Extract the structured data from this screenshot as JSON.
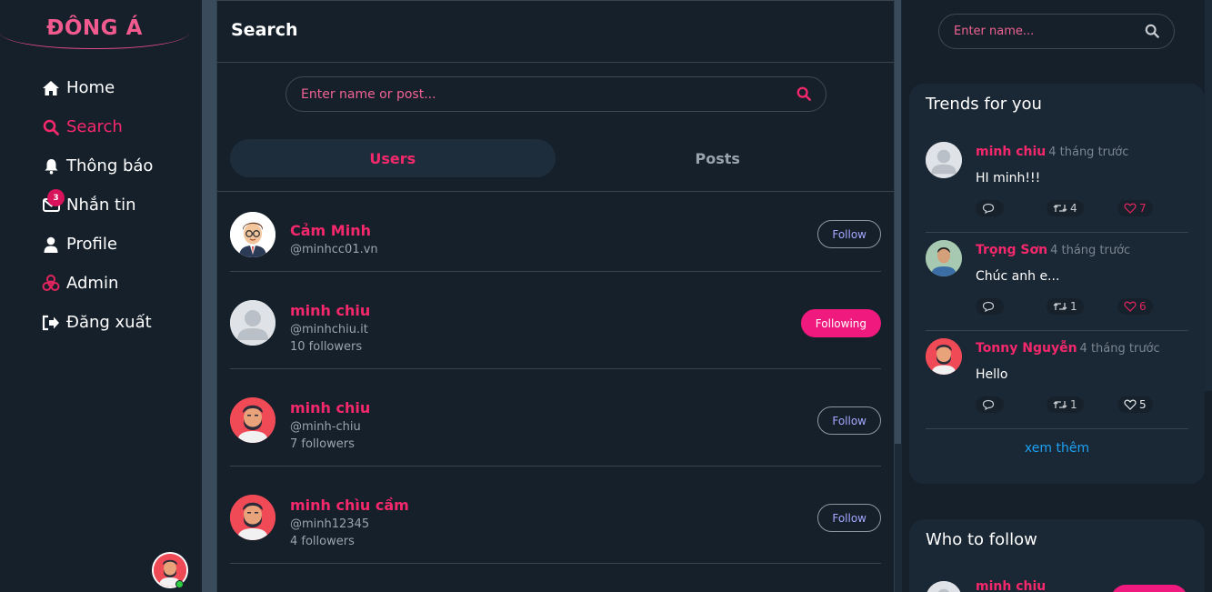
{
  "app": {
    "logo": "ĐÔNG Á"
  },
  "sidebar": {
    "items": [
      {
        "label": "Home",
        "icon": "home-icon",
        "active": false
      },
      {
        "label": "Search",
        "icon": "search-icon",
        "active": true
      },
      {
        "label": "Thông báo",
        "icon": "bell-icon",
        "active": false
      },
      {
        "label": "Nhắn tin",
        "icon": "mail-icon",
        "active": false,
        "badge": "3"
      },
      {
        "label": "Profile",
        "icon": "user-icon",
        "active": false
      },
      {
        "label": "Admin",
        "icon": "biohazard-icon",
        "active": false
      },
      {
        "label": "Đăng xuất",
        "icon": "logout-icon",
        "active": false
      }
    ]
  },
  "main": {
    "title": "Search",
    "search": {
      "placeholder": "Enter name or post..."
    },
    "tabs": [
      {
        "label": "Users",
        "active": true
      },
      {
        "label": "Posts",
        "active": false
      }
    ],
    "users": [
      {
        "name": "Cảm Minh",
        "handle": "@minhcc01.vn",
        "followers": "",
        "button": "Follow",
        "following": false
      },
      {
        "name": "minh chiu",
        "handle": "@minhchiu.it",
        "followers": "10 followers",
        "button": "Following",
        "following": true
      },
      {
        "name": "minh chiu",
        "handle": "@minh-chiu",
        "followers": "7 followers",
        "button": "Follow",
        "following": false
      },
      {
        "name": "minh chìu cầm",
        "handle": "@minh12345",
        "followers": "4 followers",
        "button": "Follow",
        "following": false
      }
    ]
  },
  "right": {
    "search": {
      "placeholder": "Enter name..."
    },
    "trends": {
      "title": "Trends for you",
      "items": [
        {
          "name": "minh chiu",
          "time": "4 tháng trước",
          "text": "HI minh!!!",
          "retweets": "4",
          "likes": "7",
          "liked": true
        },
        {
          "name": "Trọng Sơn",
          "time": "4 tháng trước",
          "text": "Chúc anh e...",
          "retweets": "1",
          "likes": "6",
          "liked": true
        },
        {
          "name": "Tonny Nguyễn",
          "time": "4 tháng trước",
          "text": "Hello",
          "retweets": "1",
          "likes": "5",
          "liked": false
        }
      ],
      "see_more": "xem thêm"
    },
    "who_to_follow": {
      "title": "Who to follow",
      "items": [
        {
          "name": "minh chiu"
        }
      ]
    }
  },
  "colors": {
    "accent": "#f5286c",
    "background": "#15202b",
    "card": "#1a2734",
    "link": "#1da1f2"
  }
}
